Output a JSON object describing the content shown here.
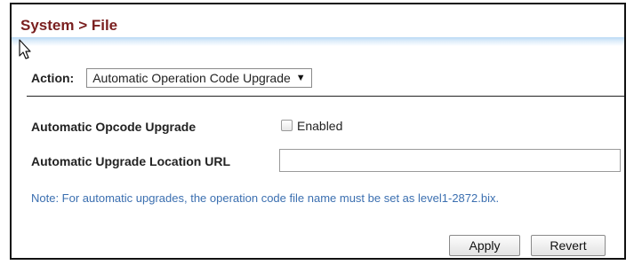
{
  "header": {
    "title": "System > File"
  },
  "action": {
    "label": "Action:",
    "selected": "Automatic Operation Code Upgrade"
  },
  "form": {
    "opcode_upgrade_label": "Automatic Opcode Upgrade",
    "opcode_upgrade_checkbox_label": "Enabled",
    "opcode_upgrade_checked": false,
    "url_label": "Automatic Upgrade Location URL",
    "url_value": ""
  },
  "note": "Note: For automatic upgrades, the operation code file name must be set as level1-2872.bix.",
  "buttons": {
    "apply": "Apply",
    "revert": "Revert"
  },
  "colors": {
    "title": "#7a1f1f",
    "note": "#3b6fb0",
    "header_rule": "#b9d8f4"
  }
}
